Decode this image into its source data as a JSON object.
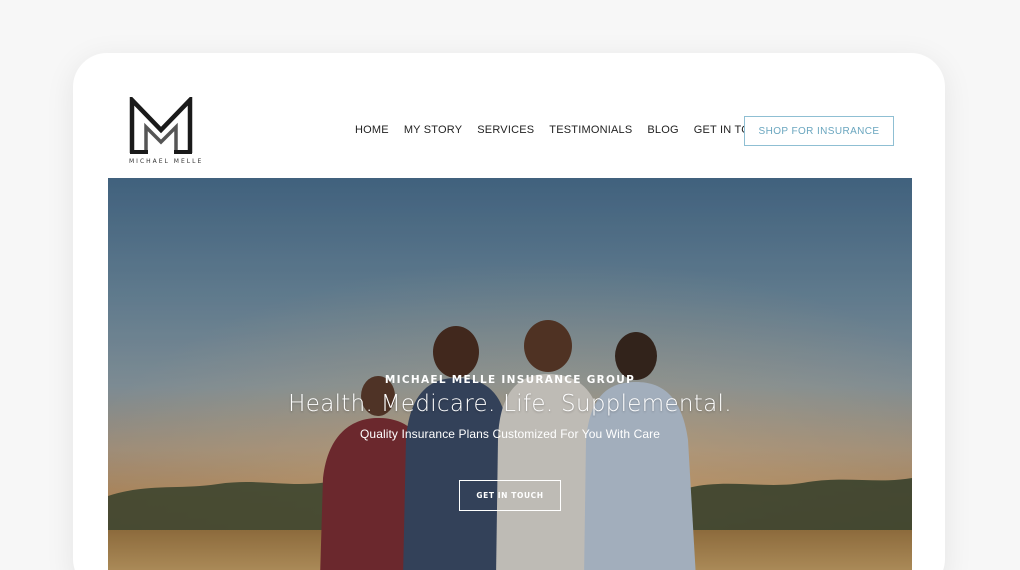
{
  "brand": {
    "logo_text": "MICHAEL MELLE"
  },
  "nav": {
    "items": [
      {
        "label": "HOME"
      },
      {
        "label": "MY STORY"
      },
      {
        "label": "SERVICES"
      },
      {
        "label": "TESTIMONIALS"
      },
      {
        "label": "BLOG"
      },
      {
        "label": "GET IN TOUCH"
      }
    ],
    "cta_label": "SHOP FOR INSURANCE"
  },
  "hero": {
    "kicker": "MICHAEL MELLE INSURANCE GROUP",
    "title": "Health. Medicare. Life. Supplemental.",
    "subtitle": "Quality Insurance Plans Customized For You With Care",
    "button_label": "GET IN TOUCH"
  },
  "colors": {
    "accent": "#6aa6bf",
    "accent_border": "#8fbfd3",
    "nav_text": "#222222"
  }
}
